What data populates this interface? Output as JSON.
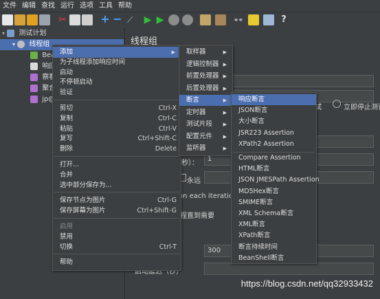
{
  "menubar": [
    "文件",
    "编辑",
    "查找",
    "运行",
    "选项",
    "工具",
    "帮助"
  ],
  "tree": {
    "root": "测试计划",
    "thread_group": "线程组",
    "children": [
      "Bea",
      "响应",
      "察看",
      "聚合",
      "jp@"
    ]
  },
  "main": {
    "title": "线程组",
    "partial_texts": {
      "continue_test": "试",
      "stop_now_radio": "立即停止测试",
      "seconds_label": "秒）：",
      "seconds_value": "1",
      "forever": "永远",
      "on_each_iteration": "on each iteration",
      "delay_until_needed": "程直到需要",
      "duration_value": "300",
      "startup_delay": "启动延迟（秒）"
    }
  },
  "context_menu": {
    "items": [
      {
        "label": "添加",
        "submenu": true,
        "highlight": true
      },
      {
        "label": "为子线程添加响应时间"
      },
      {
        "label": "启动"
      },
      {
        "label": "不停顿启动"
      },
      {
        "label": "验证"
      },
      {
        "sep": true
      },
      {
        "label": "剪切",
        "shortcut": "Ctrl-X"
      },
      {
        "label": "复制",
        "shortcut": "Ctrl-C"
      },
      {
        "label": "粘贴",
        "shortcut": "Ctrl-V"
      },
      {
        "label": "复写",
        "shortcut": "Ctrl+Shift-C"
      },
      {
        "label": "删除",
        "shortcut": "Delete"
      },
      {
        "sep": true
      },
      {
        "label": "打开..."
      },
      {
        "label": "合并"
      },
      {
        "label": "选中部分保存为..."
      },
      {
        "sep": true
      },
      {
        "label": "保存节点为图片",
        "shortcut": "Ctrl-G"
      },
      {
        "label": "保存屏幕为图片",
        "shortcut": "Ctrl+Shift-G"
      },
      {
        "sep": true
      },
      {
        "label": "启用",
        "disabled": true
      },
      {
        "label": "禁用"
      },
      {
        "label": "切换",
        "shortcut": "Ctrl-T"
      },
      {
        "sep": true
      },
      {
        "label": "帮助"
      }
    ]
  },
  "add_submenu": [
    {
      "label": "取样器"
    },
    {
      "label": "逻辑控制器"
    },
    {
      "label": "前置处理器"
    },
    {
      "label": "后置处理器"
    },
    {
      "label": "断言",
      "highlight": true
    },
    {
      "label": "定时器"
    },
    {
      "label": "测试片段"
    },
    {
      "label": "配置元件"
    },
    {
      "label": "监听器"
    }
  ],
  "assertion_submenu": [
    {
      "label": "响应断言",
      "highlight": true
    },
    {
      "label": "JSON断言"
    },
    {
      "label": "大小断言"
    },
    {
      "label": "JSR223 Assertion"
    },
    {
      "label": "XPath2 Assertion"
    },
    {
      "sep": true
    },
    {
      "label": "Compare Assertion"
    },
    {
      "label": "HTML断言"
    },
    {
      "label": "JSON JMESPath Assertion"
    },
    {
      "label": "MD5Hex断言"
    },
    {
      "label": "SMIME断言"
    },
    {
      "label": "XML Schema断言"
    },
    {
      "label": "XML断言"
    },
    {
      "label": "XPath断言"
    },
    {
      "label": "断言持续时间"
    },
    {
      "label": "BeanShell断言"
    }
  ],
  "watermark": "https://blog.csdn.net/qq32933432"
}
